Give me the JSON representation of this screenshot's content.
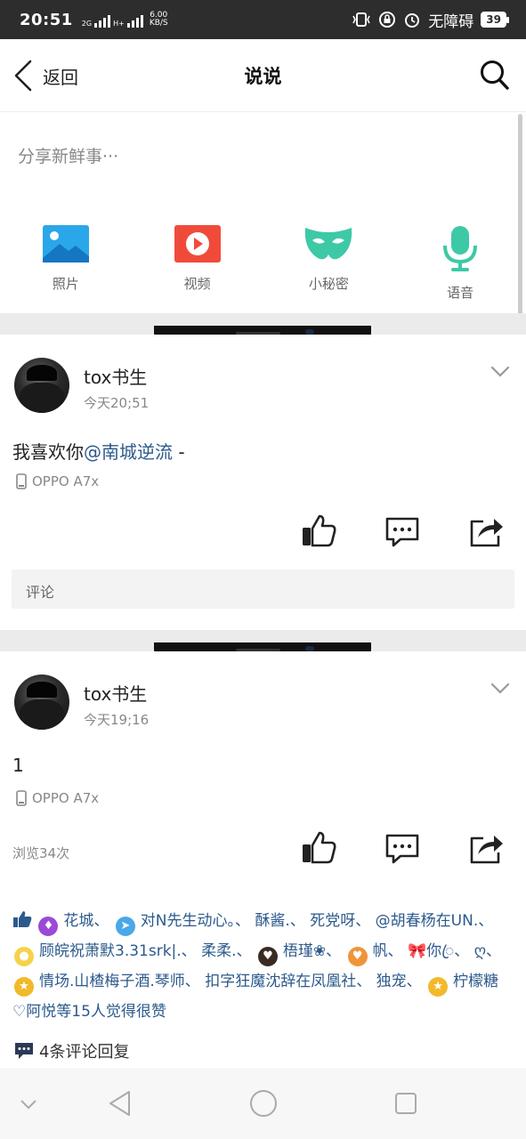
{
  "status_bar": {
    "time": "20:51",
    "net1": "2G",
    "net2": "H+",
    "speed_value": "6.00",
    "speed_unit": "KB/S",
    "accessibility": "无障碍",
    "battery": "39"
  },
  "header": {
    "back_label": "返回",
    "title": "说说"
  },
  "composer": {
    "placeholder": "分享新鲜事···",
    "actions": [
      {
        "label": "照片",
        "icon": "photo-icon",
        "color": "#2aa7ea"
      },
      {
        "label": "视频",
        "icon": "video-icon",
        "color": "#f04b3a"
      },
      {
        "label": "小秘密",
        "icon": "mask-icon",
        "color": "#3ec9a6"
      },
      {
        "label": "语音",
        "icon": "microphone-icon",
        "color": "#3ec9a6"
      }
    ]
  },
  "posts": [
    {
      "username": "tox书生",
      "time": "今天20;51",
      "content_text": "我喜欢你",
      "content_mention": "@南城逆流",
      "content_tail": " -",
      "device": "OPPO A7x",
      "comment_placeholder": "评论"
    },
    {
      "username": "tox书生",
      "time": "今天19;16",
      "content_text": "1",
      "device": "OPPO A7x",
      "views": "浏览34次"
    }
  ],
  "likes": {
    "names": [
      "花城、",
      "对N先生动心。、",
      "酥酱.、",
      "死党呀、",
      "@胡春杨在UN.、",
      "顾皖祝萧默3.31srk|.、",
      "柔柔.、",
      "梧瑾❀、",
      "帆、",
      "🎀你ꦿ、",
      "ღ、",
      "情场.山楂梅子酒.琴师、",
      "扣字狂魔沈辞在凤凰社、",
      "独宠、",
      "柠檬糖♡阿悦"
    ],
    "summary": "等15人觉得很赞"
  },
  "comments_summary": "4条评论回复",
  "colors": {
    "mention": "#2c5a8c",
    "status_bar": "#2d2d2d",
    "divider": "#ebebeb"
  }
}
